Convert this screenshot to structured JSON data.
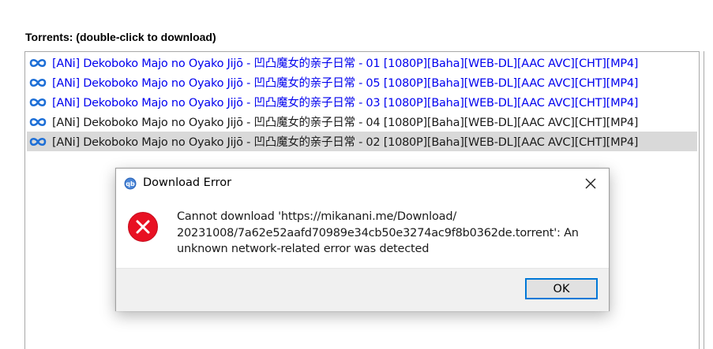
{
  "section": {
    "title": "Torrents: (double-click to download)"
  },
  "torrents": [
    {
      "name": "[ANi] Dekoboko Majo no Oyako Jijō -  凹凸魔女的亲子日常 - 01 [1080P][Baha][WEB-DL][AAC AVC][CHT][MP4]",
      "state": "visited"
    },
    {
      "name": "[ANi] Dekoboko Majo no Oyako Jijō -  凹凸魔女的亲子日常 - 05 [1080P][Baha][WEB-DL][AAC AVC][CHT][MP4]",
      "state": "visited"
    },
    {
      "name": "[ANi] Dekoboko Majo no Oyako Jijō -  凹凸魔女的亲子日常 - 03 [1080P][Baha][WEB-DL][AAC AVC][CHT][MP4]",
      "state": "visited"
    },
    {
      "name": "[ANi] Dekoboko Majo no Oyako Jijō -  凹凸魔女的亲子日常 - 04 [1080P][Baha][WEB-DL][AAC AVC][CHT][MP4]",
      "state": "normal"
    },
    {
      "name": "[ANi] Dekoboko Majo no Oyako Jijō -  凹凸魔女的亲子日常 - 02 [1080P][Baha][WEB-DL][AAC AVC][CHT][MP4]",
      "state": "selected"
    }
  ],
  "icons": {
    "torrent_row": "link-icon",
    "dialog_app": "qbittorrent-icon",
    "dialog_close": "close-icon",
    "error": "error-icon"
  },
  "colors": {
    "visited_link": "#0000ee",
    "selected_row": "#d9d9d9",
    "row_icon": "#1e6fd6",
    "error_red": "#e81123",
    "button_border": "#0078d7"
  },
  "dialog": {
    "title": "Download Error",
    "message_lines": [
      "Cannot download 'https://mikanani.me/Download/",
      "20231008/7a62e52aafd70989e34cb50e3274ac9f8b0362de.torrent': An",
      "unknown network-related error was detected"
    ],
    "ok_label": "OK"
  }
}
